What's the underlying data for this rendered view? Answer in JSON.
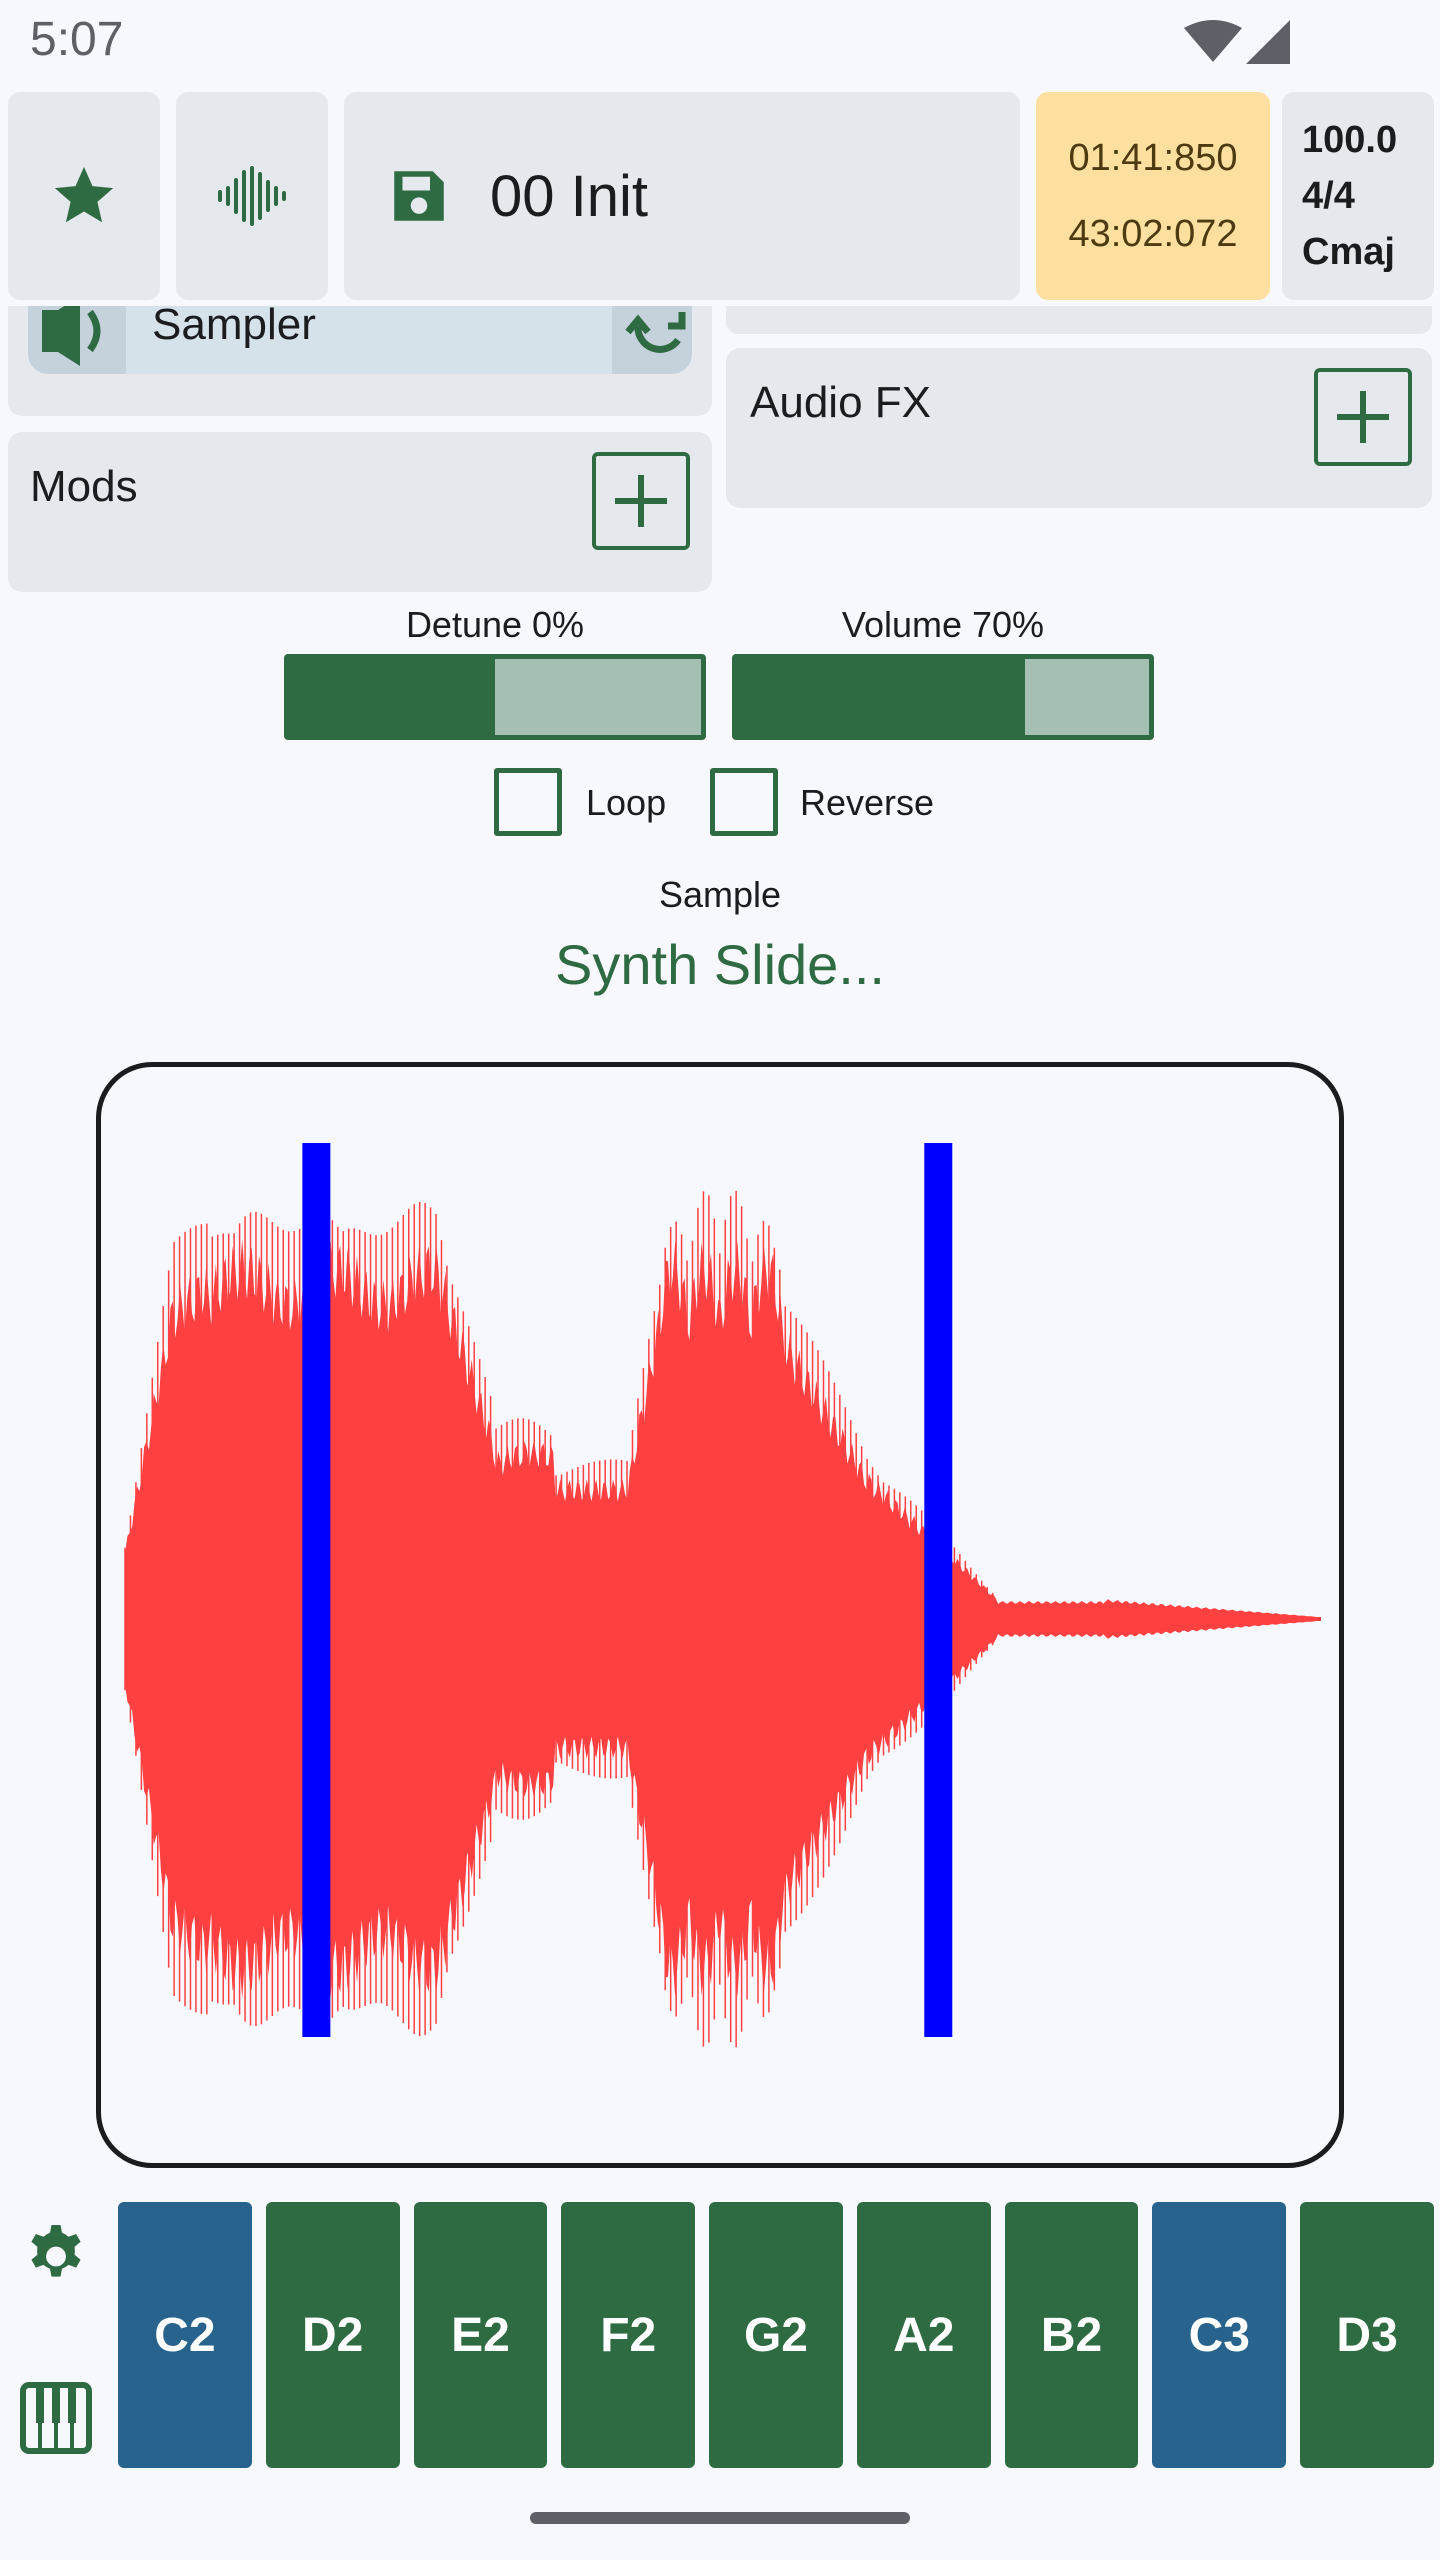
{
  "status_bar": {
    "time": "5:07"
  },
  "toolbar": {
    "favorite_icon": "star-icon",
    "waveform_icon": "waveform-icon",
    "save_icon": "floppy-disk-icon",
    "preset_name": "00 Init",
    "time_position": "01:41:850",
    "time_total": "43:02:072",
    "tempo": "100.0",
    "time_signature": "4/4",
    "key": "Cmaj"
  },
  "instrument": {
    "name": "Sampler",
    "speaker_icon": "speaker-icon",
    "swap_icon": "refresh-icon"
  },
  "mods": {
    "title": "Mods"
  },
  "audio_fx": {
    "title": "Audio FX"
  },
  "detune": {
    "label": "Detune 0%",
    "value": 0.5
  },
  "volume": {
    "label": "Volume 70%",
    "value": 0.7
  },
  "loop": {
    "label": "Loop",
    "checked": false
  },
  "reverse": {
    "label": "Reverse",
    "checked": false
  },
  "sample": {
    "label": "Sample",
    "name": "Synth Slide..."
  },
  "waveform": {
    "start_marker": 0.16,
    "end_marker": 0.68,
    "wave_color": "#ff4040",
    "marker_color": "#0000ff"
  },
  "keyboard": {
    "keys": [
      {
        "label": "C2",
        "type": "c"
      },
      {
        "label": "D2",
        "type": "white"
      },
      {
        "label": "E2",
        "type": "white"
      },
      {
        "label": "F2",
        "type": "white"
      },
      {
        "label": "G2",
        "type": "white"
      },
      {
        "label": "A2",
        "type": "white"
      },
      {
        "label": "B2",
        "type": "white"
      },
      {
        "label": "C3",
        "type": "c"
      },
      {
        "label": "D3",
        "type": "white"
      }
    ]
  },
  "colors": {
    "accent": "#2f6b42",
    "c_key": "#27638c",
    "time_bg": "#fde0a0"
  }
}
